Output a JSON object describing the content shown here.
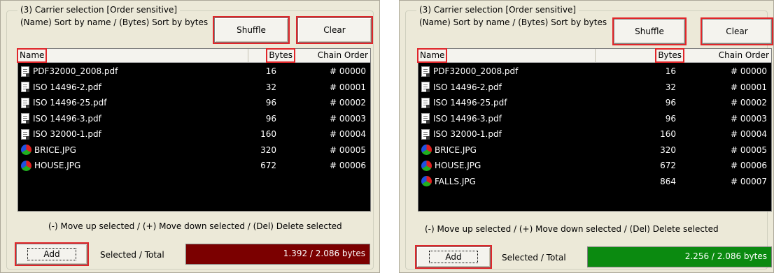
{
  "panels": [
    {
      "group_title": "(3)  Carrier selection [Order sensitive]",
      "sort_hint": "(Name) Sort by name / (Bytes) Sort by bytes",
      "shuffle_label": "Shuffle",
      "clear_label": "Clear",
      "columns": {
        "name": "Name",
        "bytes": "Bytes",
        "order": "Chain Order"
      },
      "rows": [
        {
          "icon": "document-icon",
          "name": "PDF32000_2008.pdf",
          "bytes": "16",
          "order": "# 00000"
        },
        {
          "icon": "document-icon",
          "name": "ISO 14496-2.pdf",
          "bytes": "32",
          "order": "# 00001"
        },
        {
          "icon": "document-icon",
          "name": "ISO 14496-25.pdf",
          "bytes": "96",
          "order": "# 00002"
        },
        {
          "icon": "document-icon",
          "name": "ISO 14496-3.pdf",
          "bytes": "96",
          "order": "# 00003"
        },
        {
          "icon": "document-icon",
          "name": "ISO 32000-1.pdf",
          "bytes": "160",
          "order": "# 00004"
        },
        {
          "icon": "image-icon",
          "name": "BRICE.JPG",
          "bytes": "320",
          "order": "# 00005"
        },
        {
          "icon": "image-icon",
          "name": "HOUSE.JPG",
          "bytes": "672",
          "order": "# 00006"
        }
      ],
      "move_hint": "(-) Move up selected / (+) Move down selected / (Del) Delete selected",
      "add_label": "Add",
      "selected_total_label": "Selected / Total",
      "total_value": "1.392 / 2.086 bytes",
      "total_color": "#7b0000"
    },
    {
      "group_title": "(3)  Carrier selection [Order sensitive]",
      "sort_hint": "(Name) Sort by name / (Bytes) Sort by bytes",
      "shuffle_label": "Shuffle",
      "clear_label": "Clear",
      "columns": {
        "name": "Name",
        "bytes": "Bytes",
        "order": "Chain Order"
      },
      "rows": [
        {
          "icon": "document-icon",
          "name": "PDF32000_2008.pdf",
          "bytes": "16",
          "order": "# 00000"
        },
        {
          "icon": "document-icon",
          "name": "ISO 14496-2.pdf",
          "bytes": "32",
          "order": "# 00001"
        },
        {
          "icon": "document-icon",
          "name": "ISO 14496-25.pdf",
          "bytes": "96",
          "order": "# 00002"
        },
        {
          "icon": "document-icon",
          "name": "ISO 14496-3.pdf",
          "bytes": "96",
          "order": "# 00003"
        },
        {
          "icon": "document-icon",
          "name": "ISO 32000-1.pdf",
          "bytes": "160",
          "order": "# 00004"
        },
        {
          "icon": "image-icon",
          "name": "BRICE.JPG",
          "bytes": "320",
          "order": "# 00005"
        },
        {
          "icon": "image-icon",
          "name": "HOUSE.JPG",
          "bytes": "672",
          "order": "# 00006"
        },
        {
          "icon": "image-icon",
          "name": "FALLS.JPG",
          "bytes": "864",
          "order": "# 00007"
        }
      ],
      "move_hint": "(-) Move up selected / (+) Move down selected / (Del) Delete selected",
      "add_label": "Add",
      "selected_total_label": "Selected / Total",
      "total_value": "2.256 / 2.086 bytes",
      "total_color": "#0b8a10"
    }
  ]
}
